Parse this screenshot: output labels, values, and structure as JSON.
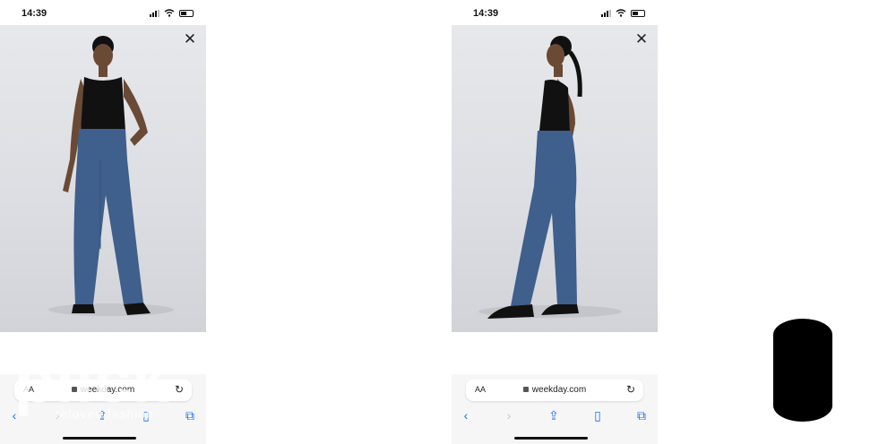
{
  "status_bar": {
    "time": "14:39"
  },
  "browser": {
    "aa_label": "AA",
    "url": "weekday.com",
    "toolbar_icons": [
      "back-icon",
      "forward-icon",
      "share-icon",
      "bookmarks-icon",
      "tabs-icon"
    ]
  },
  "viewer": {
    "close_symbol": "✕"
  },
  "watermark": {
    "brand": "plick",
    "tagline": "reloved fashion"
  },
  "colors": {
    "accent": "#1a73e8",
    "denim": "#3f5f8c",
    "top": "#111111"
  }
}
